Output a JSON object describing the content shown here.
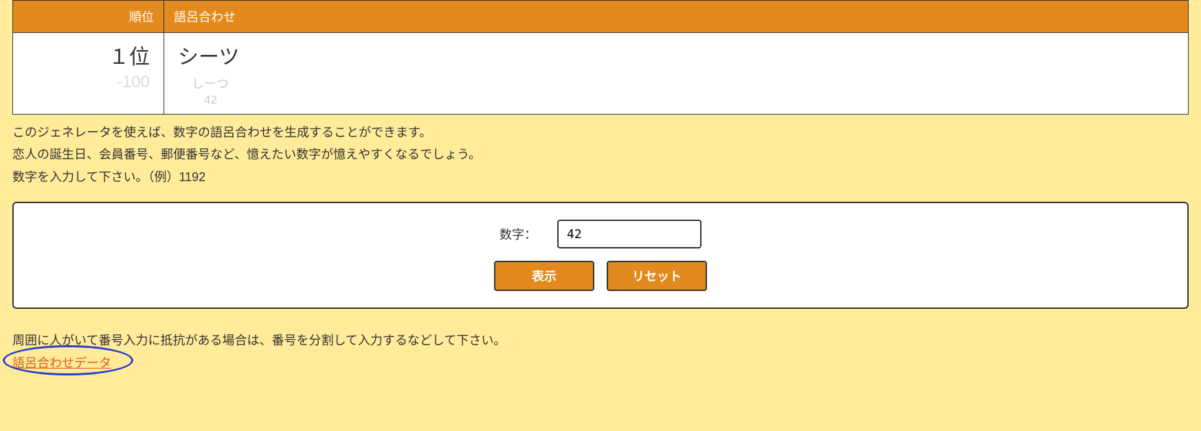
{
  "table": {
    "headers": {
      "rank": "順位",
      "goro": "語呂合わせ"
    },
    "rows": [
      {
        "rank": "１位",
        "score": "-100",
        "word": "シーツ",
        "reading": "しーつ",
        "number": "42"
      }
    ]
  },
  "description": {
    "line1": "このジェネレータを使えば、数字の語呂合わせを生成することができます。",
    "line2": "恋人の誕生日、会員番号、郵便番号など、憶えたい数字が憶えやすくなるでしょう。",
    "line3": "数字を入力して下さい。（例）1192"
  },
  "form": {
    "label": "数字：",
    "input_value": "42",
    "submit_label": "表示",
    "reset_label": "リセット"
  },
  "footer": {
    "note": "周囲に人がいて番号入力に抵抗がある場合は、番号を分割して入力するなどして下さい。",
    "link": "語呂合わせデータ"
  }
}
